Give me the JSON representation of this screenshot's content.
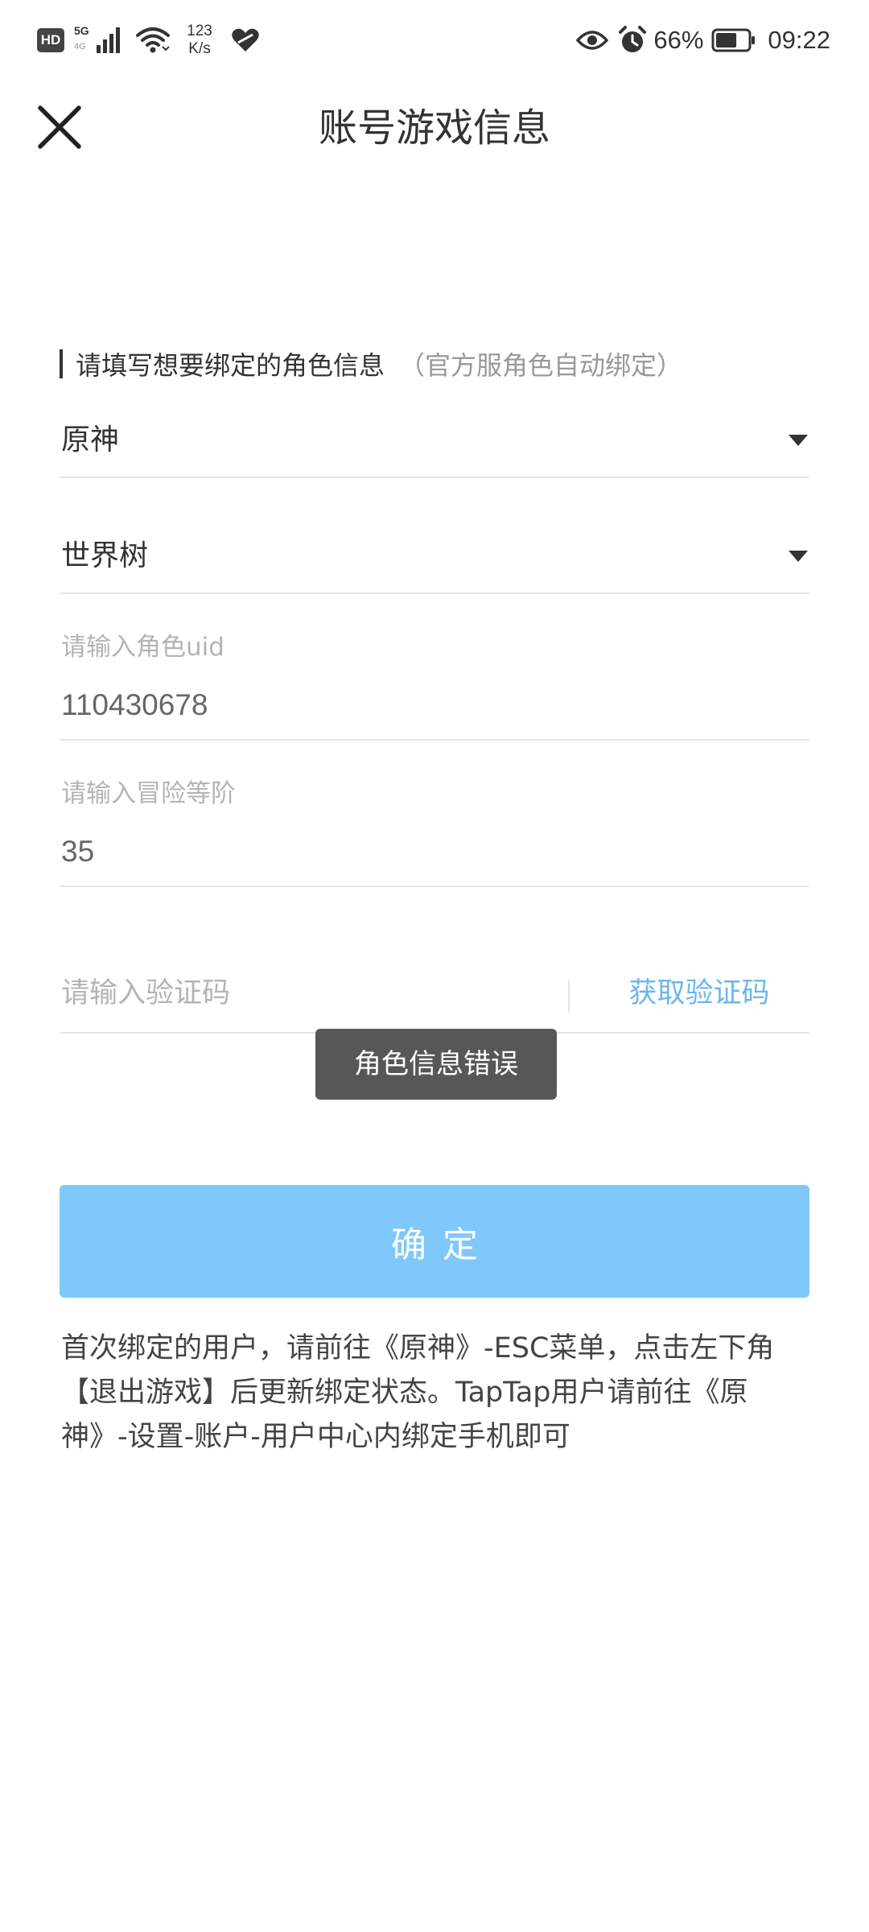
{
  "status_bar": {
    "hd_badge": "HD",
    "network_5g": "5G",
    "network_4g": "4G",
    "speed_value": "123",
    "speed_unit": "K/s",
    "battery_percent": "66%",
    "battery_level": 0.66,
    "time": "09:22",
    "icons": [
      "hd-badge",
      "signal-icon",
      "wifi-icon",
      "heart-icon",
      "eye-icon",
      "alarm-icon",
      "battery-icon"
    ]
  },
  "header": {
    "title": "账号游戏信息",
    "close_icon": "close-icon"
  },
  "form": {
    "section_label": "请填写想要绑定的角色信息",
    "section_note": "（官方服角色自动绑定）",
    "game_select": {
      "value": "原神"
    },
    "server_select": {
      "value": "世界树"
    },
    "uid": {
      "label": "请输入角色uid",
      "value": "110430678"
    },
    "adventure_rank": {
      "label": "请输入冒险等阶",
      "value": "35"
    },
    "verification": {
      "placeholder": "请输入验证码",
      "button_label": "获取验证码"
    },
    "confirm_label": "确定"
  },
  "toast": {
    "message": "角色信息错误"
  },
  "notice": "首次绑定的用户，请前往《原神》-ESC菜单，点击左下角【退出游戏】后更新绑定状态。TapTap用户请前往《原神》-设置-账户-用户中心内绑定手机即可",
  "colors": {
    "accent": "#6ab7ee",
    "confirm_bg": "#7ec8fb",
    "toast_bg": "#575757",
    "placeholder": "#b4b4b4",
    "divider": "#e6e6e6"
  }
}
